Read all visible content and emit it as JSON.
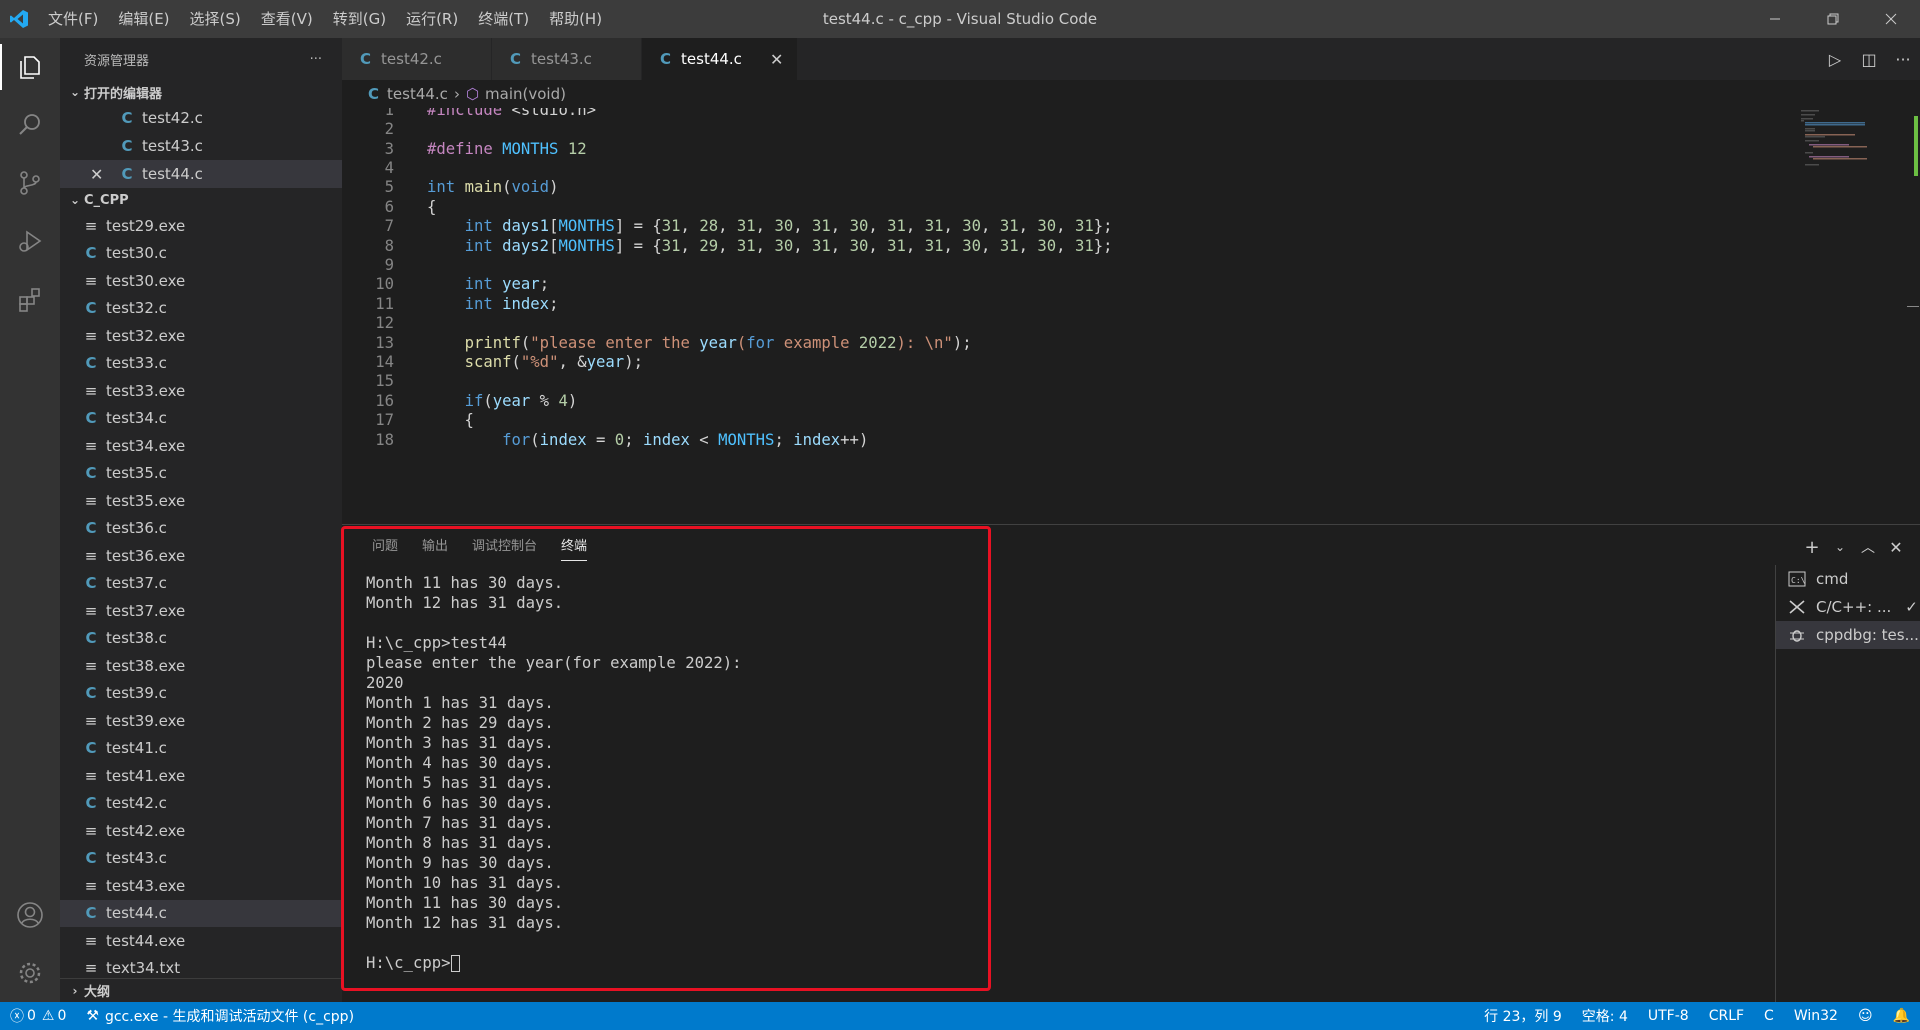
{
  "window": {
    "title": "test44.c - c_cpp - Visual Studio Code"
  },
  "menu": [
    "文件(F)",
    "编辑(E)",
    "选择(S)",
    "查看(V)",
    "转到(G)",
    "运行(R)",
    "终端(T)",
    "帮助(H)"
  ],
  "sidebar": {
    "title": "资源管理器",
    "more": "···",
    "open_editors_label": "打开的编辑器",
    "open_editors": [
      "test42.c",
      "test43.c",
      "test44.c"
    ],
    "folder_label": "C_CPP",
    "files": [
      {
        "name": "test29.exe",
        "type": "exe"
      },
      {
        "name": "test30.c",
        "type": "c"
      },
      {
        "name": "test30.exe",
        "type": "exe"
      },
      {
        "name": "test32.c",
        "type": "c"
      },
      {
        "name": "test32.exe",
        "type": "exe"
      },
      {
        "name": "test33.c",
        "type": "c"
      },
      {
        "name": "test33.exe",
        "type": "exe"
      },
      {
        "name": "test34.c",
        "type": "c"
      },
      {
        "name": "test34.exe",
        "type": "exe"
      },
      {
        "name": "test35.c",
        "type": "c"
      },
      {
        "name": "test35.exe",
        "type": "exe"
      },
      {
        "name": "test36.c",
        "type": "c"
      },
      {
        "name": "test36.exe",
        "type": "exe"
      },
      {
        "name": "test37.c",
        "type": "c"
      },
      {
        "name": "test37.exe",
        "type": "exe"
      },
      {
        "name": "test38.c",
        "type": "c"
      },
      {
        "name": "test38.exe",
        "type": "exe"
      },
      {
        "name": "test39.c",
        "type": "c"
      },
      {
        "name": "test39.exe",
        "type": "exe"
      },
      {
        "name": "test41.c",
        "type": "c"
      },
      {
        "name": "test41.exe",
        "type": "exe"
      },
      {
        "name": "test42.c",
        "type": "c"
      },
      {
        "name": "test42.exe",
        "type": "exe"
      },
      {
        "name": "test43.c",
        "type": "c"
      },
      {
        "name": "test43.exe",
        "type": "exe"
      },
      {
        "name": "test44.c",
        "type": "c",
        "active": true
      },
      {
        "name": "test44.exe",
        "type": "exe"
      },
      {
        "name": "text34.txt",
        "type": "exe"
      }
    ],
    "outline_label": "大纲"
  },
  "tabs": [
    {
      "label": "test42.c",
      "active": false
    },
    {
      "label": "test43.c",
      "active": false
    },
    {
      "label": "test44.c",
      "active": true
    }
  ],
  "breadcrumb": {
    "file": "test44.c",
    "symbol": "main(void)"
  },
  "code": [
    {
      "n": "1",
      "text": "#include <stdio.h>"
    },
    {
      "n": "2",
      "text": ""
    },
    {
      "n": "3",
      "text": "#define MONTHS 12"
    },
    {
      "n": "4",
      "text": ""
    },
    {
      "n": "5",
      "text": "int main(void)"
    },
    {
      "n": "6",
      "text": "{"
    },
    {
      "n": "7",
      "text": "    int days1[MONTHS] = {31, 28, 31, 30, 31, 30, 31, 31, 30, 31, 30, 31};"
    },
    {
      "n": "8",
      "text": "    int days2[MONTHS] = {31, 29, 31, 30, 31, 30, 31, 31, 30, 31, 30, 31};"
    },
    {
      "n": "9",
      "text": ""
    },
    {
      "n": "10",
      "text": "    int year;"
    },
    {
      "n": "11",
      "text": "    int index;"
    },
    {
      "n": "12",
      "text": ""
    },
    {
      "n": "13",
      "text": "    printf(\"please enter the year(for example 2022): \\n\");"
    },
    {
      "n": "14",
      "text": "    scanf(\"%d\", &year);"
    },
    {
      "n": "15",
      "text": ""
    },
    {
      "n": "16",
      "text": "    if(year % 4)"
    },
    {
      "n": "17",
      "text": "    {"
    },
    {
      "n": "18",
      "text": "        for(index = 0; index < MONTHS; index++)"
    }
  ],
  "panel": {
    "tabs": [
      "问题",
      "输出",
      "调试控制台",
      "终端"
    ],
    "active_tab": "终端",
    "terminal_lines": [
      "Month 11 has 30 days.",
      "Month 12 has 31 days.",
      "",
      "H:\\c_cpp>test44",
      "please enter the year(for example 2022):",
      "2020",
      "Month 1 has 31 days.",
      "Month 2 has 29 days.",
      "Month 3 has 31 days.",
      "Month 4 has 30 days.",
      "Month 5 has 31 days.",
      "Month 6 has 30 days.",
      "Month 7 has 31 days.",
      "Month 8 has 31 days.",
      "Month 9 has 30 days.",
      "Month 10 has 31 days.",
      "Month 11 has 30 days.",
      "Month 12 has 31 days.",
      "",
      "H:\\c_cpp>"
    ],
    "terminals": [
      {
        "label": "cmd",
        "icon": "terminal-icon"
      },
      {
        "label": "C/C++: ...",
        "icon": "tools-icon",
        "check": "✓"
      },
      {
        "label": "cppdbg: tes...",
        "icon": "debug-icon",
        "active": true
      }
    ]
  },
  "statusbar": {
    "errors": "0",
    "warnings": "0",
    "task": "gcc.exe - 生成和调试活动文件 (c_cpp)",
    "position": "行 23，列 9",
    "spaces": "空格: 4",
    "encoding": "UTF-8",
    "eol": "CRLF",
    "language": "C",
    "platform": "Win32"
  },
  "colors": {
    "accent": "#007acc",
    "highlight_box": "#e81123"
  }
}
